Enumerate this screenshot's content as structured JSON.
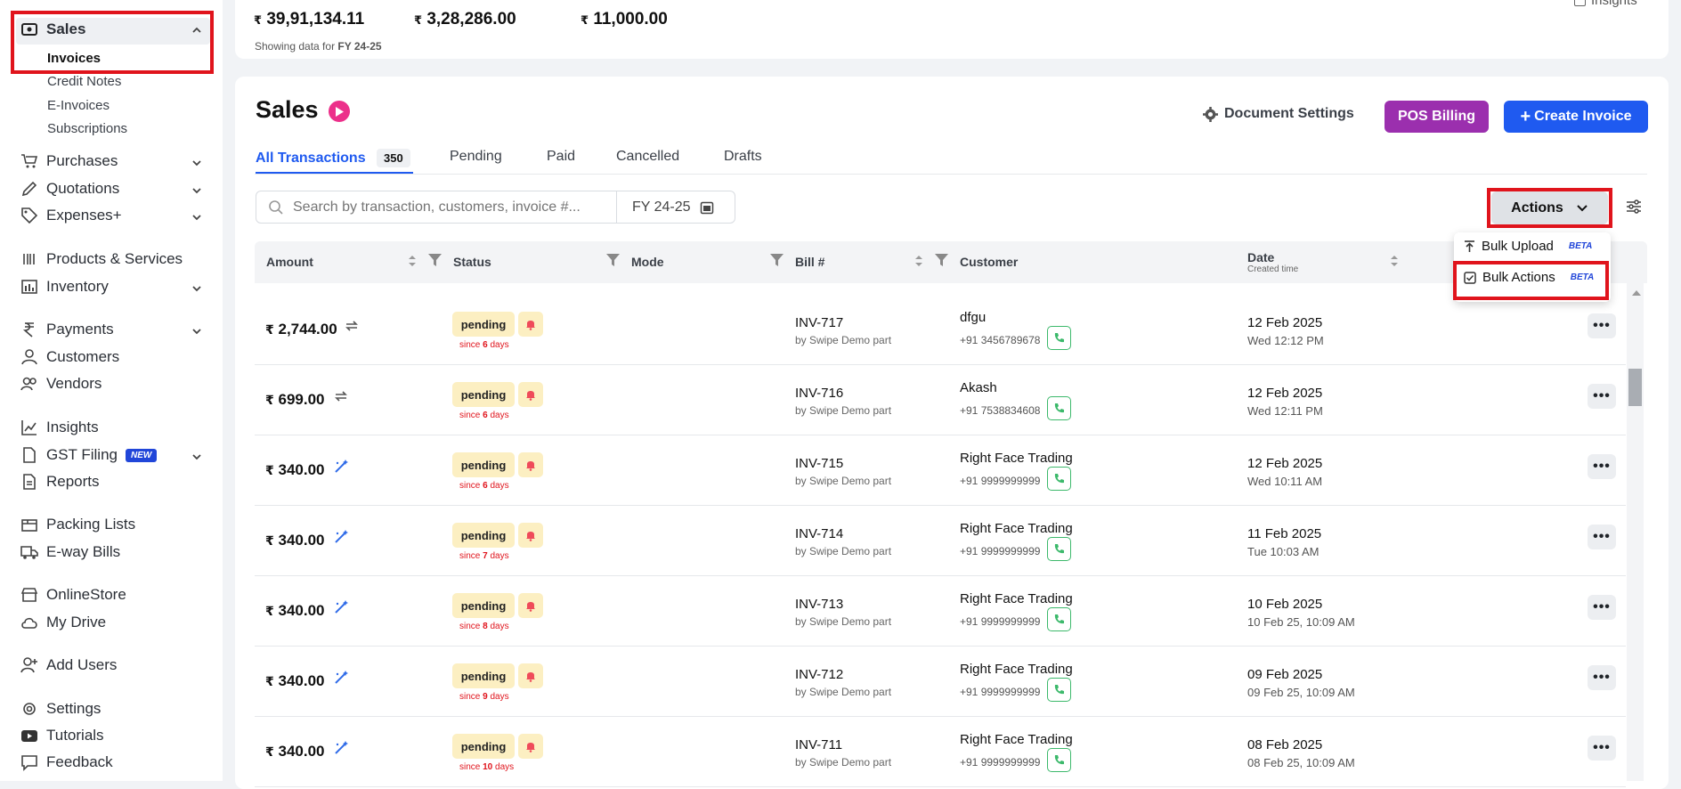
{
  "sidebar": {
    "sales": "Sales",
    "sub_items": [
      "Invoices",
      "Credit Notes",
      "E-Invoices",
      "Subscriptions"
    ],
    "items": [
      {
        "label": "Purchases",
        "icon": "cart-icon",
        "chevron": true
      },
      {
        "label": "Quotations",
        "icon": "pencil-icon",
        "chevron": true
      },
      {
        "label": "Expenses+",
        "icon": "tag-icon",
        "chevron": true
      },
      {
        "label": "Products & Services",
        "icon": "barcode-icon",
        "chevron": false
      },
      {
        "label": "Inventory",
        "icon": "inventory-icon",
        "chevron": true
      },
      {
        "label": "Payments",
        "icon": "rupee-icon",
        "chevron": true
      },
      {
        "label": "Customers",
        "icon": "user-icon",
        "chevron": false
      },
      {
        "label": "Vendors",
        "icon": "users-icon",
        "chevron": false
      },
      {
        "label": "Insights",
        "icon": "chart-icon",
        "chevron": false
      },
      {
        "label": "GST Filing",
        "icon": "document-icon",
        "chevron": true,
        "badge": "NEW"
      },
      {
        "label": "Reports",
        "icon": "report-icon",
        "chevron": false
      },
      {
        "label": "Packing Lists",
        "icon": "box-icon",
        "chevron": false
      },
      {
        "label": "E-way Bills",
        "icon": "truck-icon",
        "chevron": false
      },
      {
        "label": "OnlineStore",
        "icon": "store-icon",
        "chevron": false
      },
      {
        "label": "My Drive",
        "icon": "cloud-icon",
        "chevron": false
      },
      {
        "label": "Add Users",
        "icon": "user-plus-icon",
        "chevron": false
      },
      {
        "label": "Settings",
        "icon": "gear-icon",
        "chevron": false
      },
      {
        "label": "Tutorials",
        "icon": "youtube-icon",
        "chevron": false
      },
      {
        "label": "Feedback",
        "icon": "feedback-icon",
        "chevron": false
      }
    ]
  },
  "summary": {
    "total": "39,91,134.11",
    "paid": "3,28,286.00",
    "pending": "11,000.00",
    "currency": "₹",
    "showing_prefix": "Showing data for",
    "fy": "FY 24-25",
    "insights": "Insights"
  },
  "header": {
    "title": "Sales",
    "document_settings": "Document Settings",
    "pos_billing": "POS Billing",
    "create_invoice": "Create Invoice"
  },
  "tabs": {
    "all": "All Transactions",
    "all_count": "350",
    "pending": "Pending",
    "paid": "Paid",
    "cancelled": "Cancelled",
    "drafts": "Drafts"
  },
  "search": {
    "placeholder": "Search by transaction, customers, invoice #...",
    "fy": "FY 24-25"
  },
  "actions": {
    "label": "Actions",
    "bulk_upload": "Bulk Upload",
    "bulk_actions": "Bulk Actions",
    "beta": "BETA"
  },
  "columns": {
    "amount": "Amount",
    "status": "Status",
    "mode": "Mode",
    "bill": "Bill #",
    "customer": "Customer",
    "date": "Date",
    "date_sub": "Created time"
  },
  "rows": [
    {
      "amount": "2,744.00",
      "icon": "recurring-icon",
      "status": "pending",
      "since_a": "since ",
      "since_n": "6",
      "since_b": " days",
      "bill": "INV-717",
      "by": "by Swipe Demo part",
      "customer": "dfgu",
      "phone": "+91  3456789678",
      "date": "12 Feb 2025",
      "time": "Wed 12:12 PM"
    },
    {
      "amount": "699.00",
      "icon": "recurring-icon",
      "status": "pending",
      "since_a": "since ",
      "since_n": "6",
      "since_b": " days",
      "bill": "INV-716",
      "by": "by Swipe Demo part",
      "customer": "Akash",
      "phone": "+91  7538834608",
      "date": "12 Feb 2025",
      "time": "Wed 12:11 PM"
    },
    {
      "amount": "340.00",
      "icon": "magic-wand-icon",
      "status": "pending",
      "since_a": "since ",
      "since_n": "6",
      "since_b": " days",
      "bill": "INV-715",
      "by": "by Swipe Demo part",
      "customer": "Right Face Trading",
      "phone": "+91  9999999999",
      "date": "12 Feb 2025",
      "time": "Wed 10:11 AM"
    },
    {
      "amount": "340.00",
      "icon": "magic-wand-icon",
      "status": "pending",
      "since_a": "since ",
      "since_n": "7",
      "since_b": " days",
      "bill": "INV-714",
      "by": "by Swipe Demo part",
      "customer": "Right Face Trading",
      "phone": "+91  9999999999",
      "date": "11 Feb 2025",
      "time": "Tue 10:03 AM"
    },
    {
      "amount": "340.00",
      "icon": "magic-wand-icon",
      "status": "pending",
      "since_a": "since ",
      "since_n": "8",
      "since_b": " days",
      "bill": "INV-713",
      "by": "by Swipe Demo part",
      "customer": "Right Face Trading",
      "phone": "+91  9999999999",
      "date": "10 Feb 2025",
      "time": "10 Feb 25, 10:09 AM"
    },
    {
      "amount": "340.00",
      "icon": "magic-wand-icon",
      "status": "pending",
      "since_a": "since ",
      "since_n": "9",
      "since_b": " days",
      "bill": "INV-712",
      "by": "by Swipe Demo part",
      "customer": "Right Face Trading",
      "phone": "+91  9999999999",
      "date": "09 Feb 2025",
      "time": "09 Feb 25, 10:09 AM"
    },
    {
      "amount": "340.00",
      "icon": "magic-wand-icon",
      "status": "pending",
      "since_a": "since ",
      "since_n": "10",
      "since_b": " days",
      "bill": "INV-711",
      "by": "by Swipe Demo part",
      "customer": "Right Face Trading",
      "phone": "+91  9999999999",
      "date": "08 Feb 2025",
      "time": "08 Feb 25, 10:09 AM"
    }
  ],
  "colors": {
    "accent": "#1f5af0",
    "pos": "#9b2fae",
    "create": "#1f5af0",
    "highlight": "#e0141c",
    "pending_bg": "#fcefc2",
    "bell": "#ef4b5a",
    "call": "#3cb96b",
    "new_badge": "#2146d9"
  }
}
